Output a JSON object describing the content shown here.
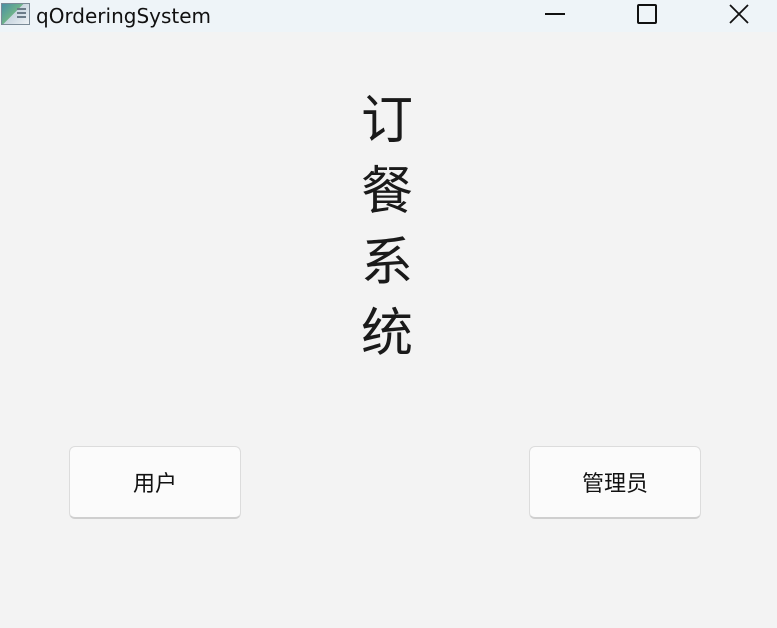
{
  "window": {
    "title": "qOrderingSystem"
  },
  "headline": "订餐系统",
  "buttons": {
    "user_label": "用户",
    "admin_label": "管理员"
  },
  "colors": {
    "background": "#f3f3f3",
    "titlebar": "#eef4f8",
    "button_face": "#fbfbfb"
  },
  "icons": {
    "app": "app-window-icon",
    "minimize": "minimize-icon",
    "maximize": "maximize-icon",
    "close": "close-icon"
  }
}
